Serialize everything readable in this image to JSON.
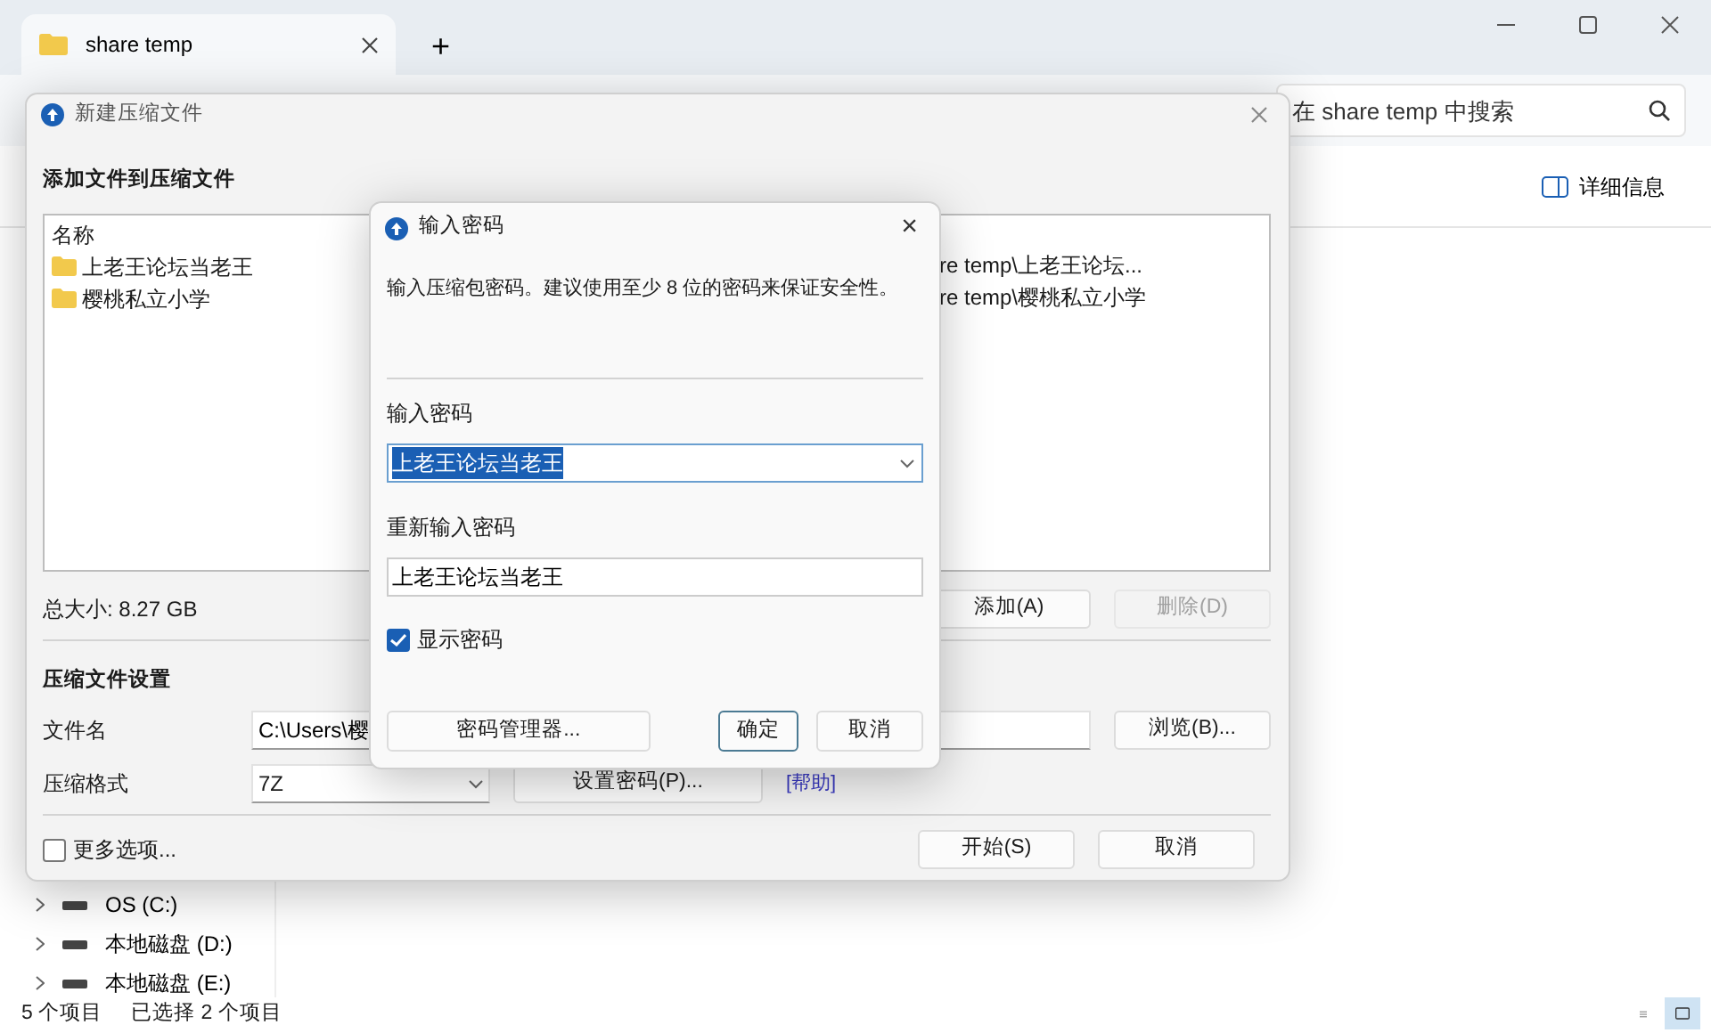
{
  "explorer": {
    "tabs": [
      {
        "title": "share temp",
        "selected": true
      }
    ],
    "new_tab": "+",
    "search": {
      "placeholder": "在 share temp 中搜索"
    },
    "details_button": "详细信息",
    "nav_items": [
      {
        "label": "OS (C:)"
      },
      {
        "label": "本地磁盘 (D:)"
      },
      {
        "label": "本地磁盘 (E:)"
      }
    ],
    "status_bar": {
      "item_count": "5 个项目",
      "selected_count": "已选择 2 个项目"
    }
  },
  "archive_dialog": {
    "title": "新建压缩文件",
    "heading": "添加文件到压缩文件",
    "files": {
      "columns": [
        "名称"
      ],
      "rows": [
        {
          "name": "上老王论坛当老王",
          "path": "re temp\\上老王论坛..."
        },
        {
          "name": "樱桃私立小学",
          "path": "re temp\\樱桃私立小学"
        }
      ]
    },
    "total_size": "总大小: 8.27 GB",
    "add_button": {
      "label": "添加(A)",
      "disabled": false
    },
    "delete_button": {
      "label": "删除(D)",
      "disabled": true
    },
    "settings_heading": "压缩文件设置",
    "filename": {
      "label": "文件名",
      "value": "C:\\Users\\樱"
    },
    "browse_button": "浏览(B)...",
    "format": {
      "label": "压缩格式",
      "value": "7Z"
    },
    "set_password_button": "设置密码(P)...",
    "help_link": "[帮助]",
    "more_options": {
      "label": "更多选项...",
      "checked": false
    },
    "start_button": "开始(S)",
    "cancel_button": "取消"
  },
  "password_dialog": {
    "title": "输入密码",
    "close": "×",
    "message": "输入压缩包密码。建议使用至少 8 位的密码来保证安全性。",
    "password": {
      "label": "输入密码",
      "value": "上老王论坛当老王",
      "text_selected": true
    },
    "confirm": {
      "label": "重新输入密码",
      "value": "上老王论坛当老王"
    },
    "show_password": {
      "label": "显示密码",
      "checked": true
    },
    "buttons": [
      {
        "label": "密码管理器...",
        "default": false
      },
      {
        "label": "确定",
        "default": true
      },
      {
        "label": "取消",
        "default": false
      }
    ]
  }
}
